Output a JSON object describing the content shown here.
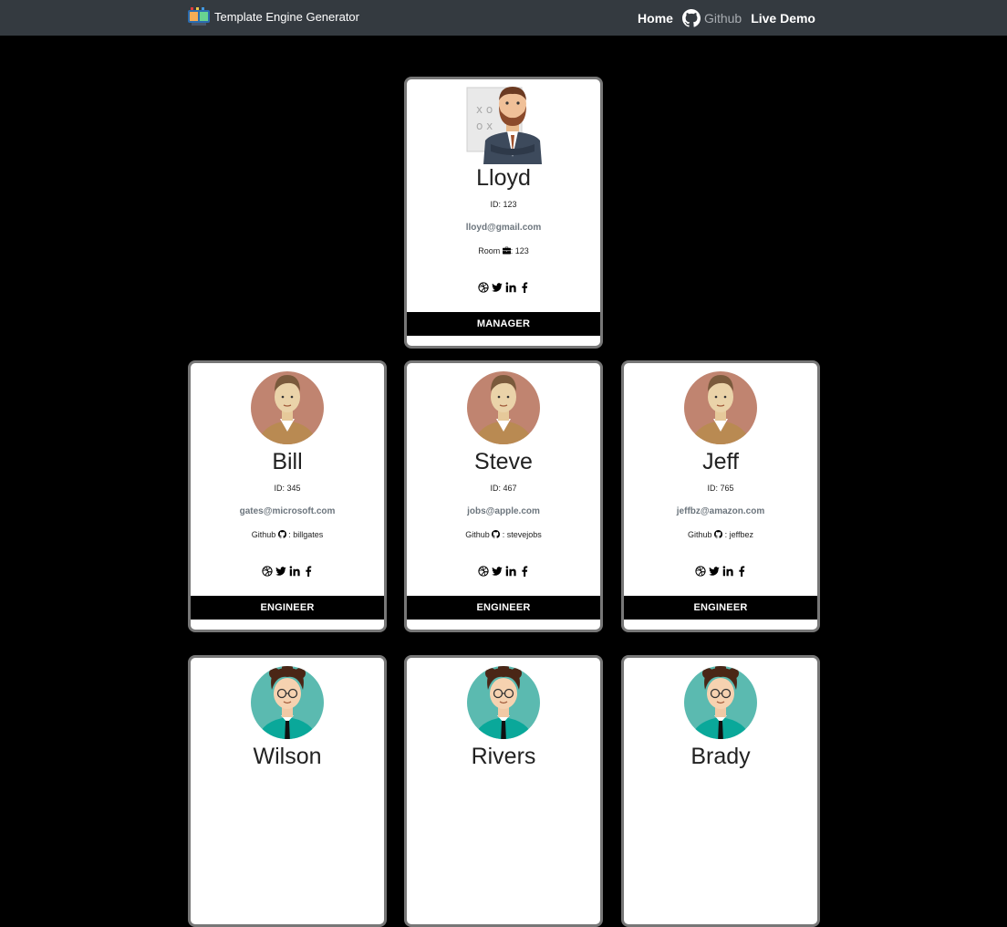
{
  "nav": {
    "brand": "Template Engine Generator",
    "links": [
      {
        "label": "Home"
      },
      {
        "label": "Github"
      },
      {
        "label": "Live Demo"
      }
    ]
  },
  "cards": [
    {
      "name": "Lloyd",
      "id": "ID: 123",
      "email": "lloyd@gmail.com",
      "extra_prefix": "Room",
      "extra_value": ": 123",
      "role": "MANAGER",
      "avatar": "manager-avatar-icon"
    },
    {
      "name": "Bill",
      "id": "ID: 345",
      "email": "gates@microsoft.com",
      "extra_prefix": "Github",
      "extra_value": " : billgates",
      "role": "ENGINEER",
      "avatar": "engineer-avatar-icon"
    },
    {
      "name": "Steve",
      "id": "ID: 467",
      "email": "jobs@apple.com",
      "extra_prefix": "Github",
      "extra_value": " : stevejobs",
      "role": "ENGINEER",
      "avatar": "engineer-avatar-icon"
    },
    {
      "name": "Jeff",
      "id": "ID: 765",
      "email": "jeffbz@amazon.com",
      "extra_prefix": "Github",
      "extra_value": " : jeffbez",
      "role": "ENGINEER",
      "avatar": "engineer-avatar-icon"
    },
    {
      "name": "Wilson",
      "avatar": "intern-avatar-icon"
    },
    {
      "name": "Rivers",
      "avatar": "intern-avatar-icon"
    },
    {
      "name": "Brady",
      "avatar": "intern-avatar-icon"
    }
  ],
  "colors": {
    "navbar": "#343a40",
    "background": "#000000",
    "role_bar": "#000000"
  }
}
